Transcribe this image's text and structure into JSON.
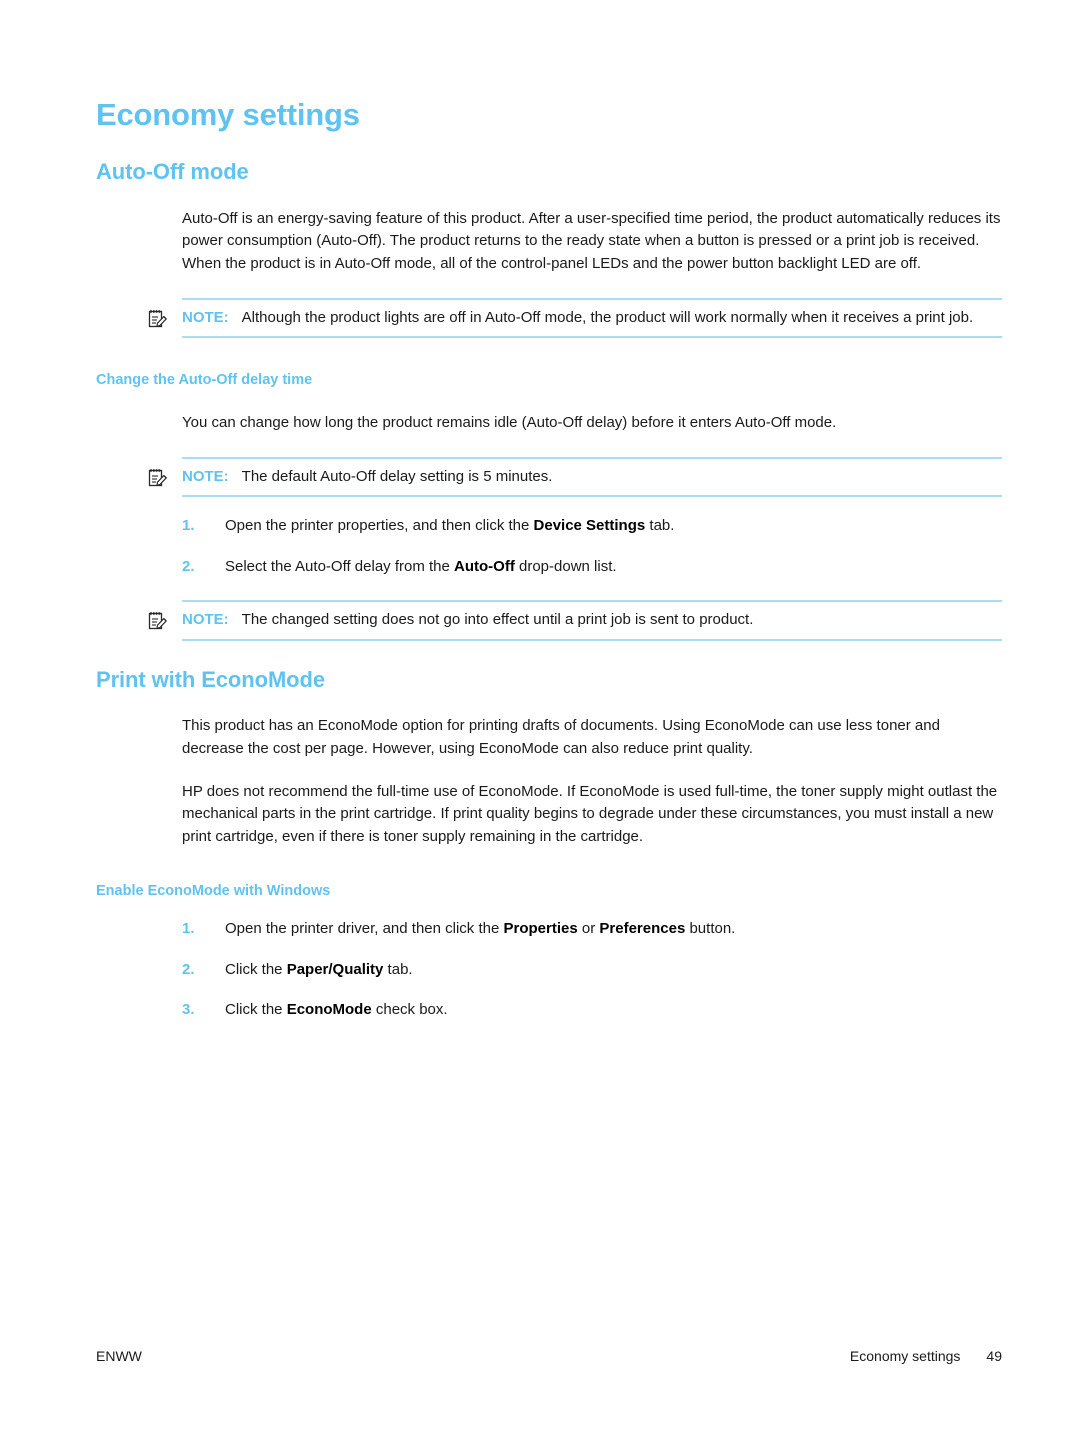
{
  "page": {
    "title": "Economy settings",
    "sections": [
      {
        "heading": "Auto-Off mode",
        "paragraph": "Auto-Off is an energy-saving feature of this product. After a user-specified time period, the product automatically reduces its power consumption (Auto-Off). The product returns to the ready state when a button is pressed or a print job is received. When the product is in Auto-Off mode, all of the control-panel LEDs and the power button backlight LED are off.",
        "note": {
          "label": "NOTE:",
          "icon": "note-pencil-icon",
          "text": "Although the product lights are off in Auto-Off mode, the product will work normally when it receives a print job."
        },
        "subsection": {
          "heading": "Change the Auto-Off delay time",
          "paragraph": "You can change how long the product remains idle (Auto-Off delay) before it enters Auto-Off mode.",
          "note_before": {
            "label": "NOTE:",
            "icon": "note-pencil-icon",
            "text": "The default Auto-Off delay setting is 5 minutes."
          },
          "steps": [
            {
              "num": "1.",
              "parts": [
                {
                  "text": "Open the printer properties, and then click the ",
                  "bold": false
                },
                {
                  "text": "Device Settings",
                  "bold": true
                },
                {
                  "text": " tab.",
                  "bold": false
                }
              ]
            },
            {
              "num": "2.",
              "parts": [
                {
                  "text": "Select the Auto-Off delay from the ",
                  "bold": false
                },
                {
                  "text": "Auto-Off",
                  "bold": true
                },
                {
                  "text": " drop-down list.",
                  "bold": false
                }
              ]
            }
          ],
          "note_after": {
            "label": "NOTE:",
            "icon": "note-pencil-icon",
            "text": "The changed setting does not go into effect until a print job is sent to product."
          }
        }
      },
      {
        "heading": "Print with EconoMode",
        "paragraph1": "This product has an EconoMode option for printing drafts of documents. Using EconoMode can use less toner and decrease the cost per page. However, using EconoMode can also reduce print quality.",
        "paragraph2": "HP does not recommend the full-time use of EconoMode. If EconoMode is used full-time, the toner supply might outlast the mechanical parts in the print cartridge. If print quality begins to degrade under these circumstances, you must install a new print cartridge, even if there is toner supply remaining in the cartridge.",
        "subsection": {
          "heading": "Enable EconoMode with Windows",
          "steps": [
            {
              "num": "1.",
              "parts": [
                {
                  "text": "Open the printer driver, and then click the ",
                  "bold": false
                },
                {
                  "text": "Properties",
                  "bold": true
                },
                {
                  "text": " or ",
                  "bold": false
                },
                {
                  "text": "Preferences",
                  "bold": true
                },
                {
                  "text": " button.",
                  "bold": false
                }
              ]
            },
            {
              "num": "2.",
              "parts": [
                {
                  "text": "Click the ",
                  "bold": false
                },
                {
                  "text": "Paper/Quality",
                  "bold": true
                },
                {
                  "text": " tab.",
                  "bold": false
                }
              ]
            },
            {
              "num": "3.",
              "parts": [
                {
                  "text": "Click the ",
                  "bold": false
                },
                {
                  "text": "EconoMode",
                  "bold": true
                },
                {
                  "text": " check box.",
                  "bold": false
                }
              ]
            }
          ]
        }
      }
    ],
    "footer": {
      "left": "ENWW",
      "section": "Economy settings",
      "page_number": "49"
    }
  },
  "colors": {
    "heading_blue": "#5fc3f2",
    "rule_blue": "#aadcf5",
    "body_text": "#1a1a1a"
  }
}
